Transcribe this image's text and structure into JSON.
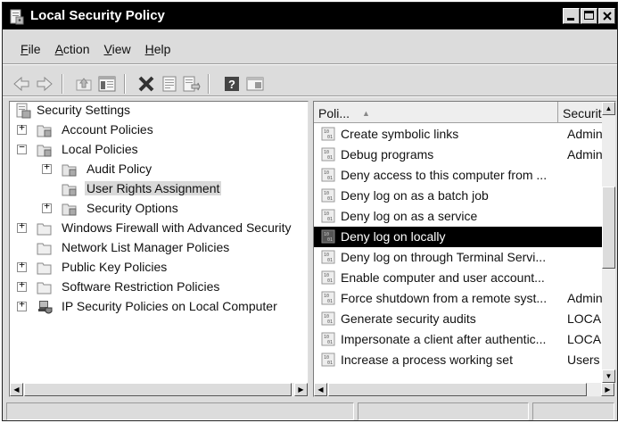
{
  "window": {
    "title": "Local Security Policy"
  },
  "menu": [
    {
      "pre": "",
      "key": "F",
      "post": "ile"
    },
    {
      "pre": "",
      "key": "A",
      "post": "ction"
    },
    {
      "pre": "",
      "key": "V",
      "post": "iew"
    },
    {
      "pre": "",
      "key": "H",
      "post": "elp"
    }
  ],
  "toolbar": {
    "icons": [
      "back-icon",
      "forward-icon",
      "up-folder-icon",
      "show-hide-tree-icon",
      "delete-icon",
      "properties-icon",
      "export-list-icon",
      "help-icon",
      "console-icon"
    ]
  },
  "tree": {
    "root": "Security Settings",
    "nodes": [
      {
        "label": "Account Policies",
        "expander": "+"
      },
      {
        "label": "Local Policies",
        "expander": "−"
      },
      {
        "label": "Audit Policy",
        "expander": "+"
      },
      {
        "label": "User Rights Assignment",
        "expander": ""
      },
      {
        "label": "Security Options",
        "expander": "+"
      },
      {
        "label": "Windows Firewall with Advanced Security",
        "expander": "+"
      },
      {
        "label": "Network List Manager Policies",
        "expander": ""
      },
      {
        "label": "Public Key Policies",
        "expander": "+"
      },
      {
        "label": "Software Restriction Policies",
        "expander": "+"
      },
      {
        "label": "IP Security Policies on Local Computer",
        "expander": "+"
      }
    ],
    "selected": "User Rights Assignment"
  },
  "list": {
    "columns": {
      "policy": "Poli...",
      "sort_indicator": "▲",
      "setting": "Security"
    },
    "rows": [
      {
        "policy": "Create symbolic links",
        "setting": "Adminis"
      },
      {
        "policy": "Debug programs",
        "setting": "Adminis"
      },
      {
        "policy": "Deny access to this computer from ...",
        "setting": ""
      },
      {
        "policy": "Deny log on as a batch job",
        "setting": ""
      },
      {
        "policy": "Deny log on as a service",
        "setting": ""
      },
      {
        "policy": "Deny log on locally",
        "setting": ""
      },
      {
        "policy": "Deny log on through Terminal Servi...",
        "setting": ""
      },
      {
        "policy": "Enable computer and user account...",
        "setting": ""
      },
      {
        "policy": "Force shutdown from a remote syst...",
        "setting": "Adminis"
      },
      {
        "policy": "Generate security audits",
        "setting": "LOCAL"
      },
      {
        "policy": "Impersonate a client after authentic...",
        "setting": "LOCAL"
      },
      {
        "policy": "Increase a process working set",
        "setting": "Users"
      }
    ],
    "selected_row": "Deny log on locally"
  },
  "colors": {
    "titlebar": "#000000",
    "selection": "#000000",
    "chrome": "#dcdcdc"
  }
}
